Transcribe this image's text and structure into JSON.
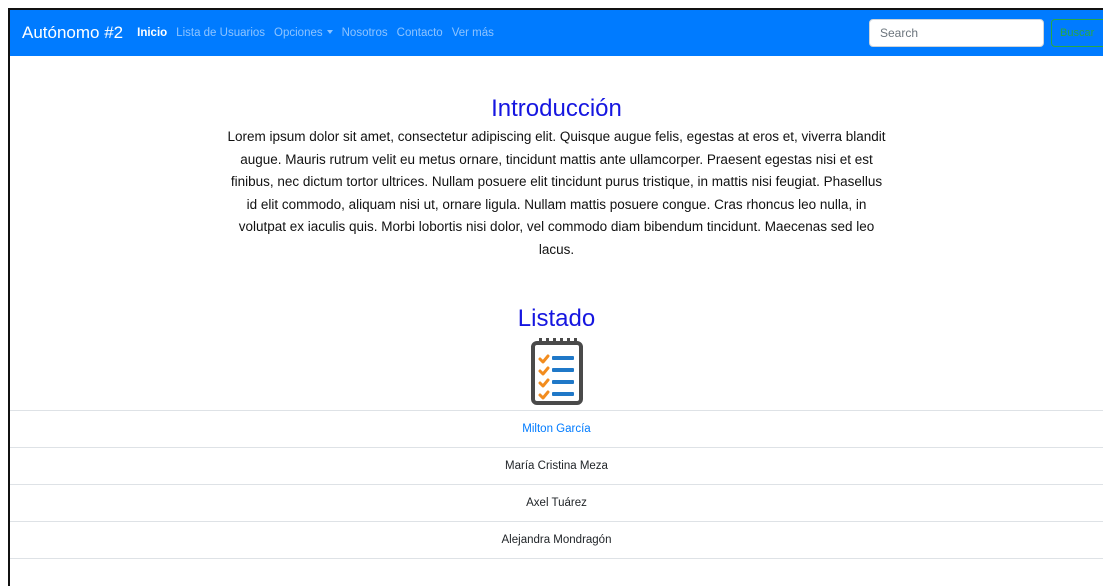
{
  "navbar": {
    "brand": "Autónomo #2",
    "links": [
      {
        "label": "Inicio",
        "active": true
      },
      {
        "label": "Lista de Usuarios"
      },
      {
        "label": "Opciones"
      },
      {
        "label": "Nosotros"
      },
      {
        "label": "Contacto"
      },
      {
        "label": "Ver más"
      }
    ],
    "search": {
      "placeholder": "Search",
      "button_label": "Buscar"
    }
  },
  "intro": {
    "title": "Introducción",
    "text": "Lorem ipsum dolor sit amet, consectetur adipiscing elit. Quisque augue felis, egestas at eros et, viverra blandit augue. Mauris rutrum velit eu metus ornare, tincidunt mattis ante ullamcorper. Praesent egestas nisi et est finibus, nec dictum tortor ultrices. Nullam posuere elit tincidunt purus tristique, in mattis nisi feugiat. Phasellus id elit commodo, aliquam nisi ut, ornare ligula. Nullam mattis posuere congue. Cras rhoncus leo nulla, in volutpat ex iaculis quis. Morbi lobortis nisi dolor, vel commodo diam bibendum tincidunt. Maecenas sed leo lacus."
  },
  "listado": {
    "title": "Listado",
    "icon": "checklist-icon",
    "users": [
      {
        "name": "Milton García",
        "active": true
      },
      {
        "name": "María Cristina Meza"
      },
      {
        "name": "Axel Tuárez"
      },
      {
        "name": "Alejandra Mondragón"
      }
    ]
  },
  "colors": {
    "navbar": "#007bff",
    "title": "#1616e0",
    "active_item": "#007bff",
    "search_button": "#28a745"
  }
}
